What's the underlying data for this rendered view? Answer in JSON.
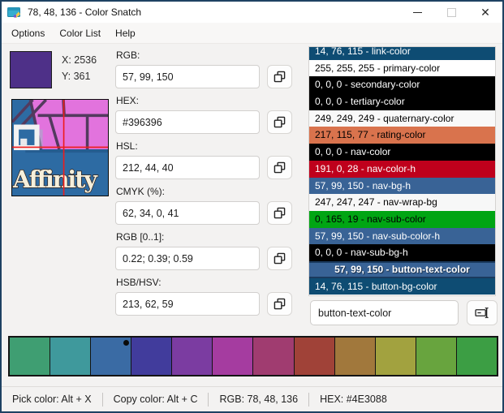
{
  "window": {
    "title": "78, 48, 136 - Color Snatch"
  },
  "menu": {
    "items": [
      "Options",
      "Color List",
      "Help"
    ]
  },
  "picker": {
    "coord_x": "X: 2536",
    "coord_y": "Y: 361",
    "swatch_color": "#4E3088",
    "preview_label": "Affinity"
  },
  "fields": [
    {
      "label": "RGB:",
      "value": "57, 99, 150"
    },
    {
      "label": "HEX:",
      "value": "#396396"
    },
    {
      "label": "HSL:",
      "value": "212, 44, 40"
    },
    {
      "label": "CMYK (%):",
      "value": "62, 34, 0, 41"
    },
    {
      "label": "RGB [0..1]:",
      "value": "0.22; 0.39; 0.59"
    },
    {
      "label": "HSB/HSV:",
      "value": "213, 62, 59"
    }
  ],
  "color_list": {
    "items": [
      {
        "text": "14, 76, 115 - link-color",
        "bg": "#0E4C73",
        "fg": "#FFFFFF",
        "selected": false
      },
      {
        "text": "255, 255, 255 - primary-color",
        "bg": "#FFFFFF",
        "fg": "#000000",
        "selected": false
      },
      {
        "text": "0, 0, 0 - secondary-color",
        "bg": "#000000",
        "fg": "#FFFFFF",
        "selected": false
      },
      {
        "text": "0, 0, 0 - tertiary-color",
        "bg": "#000000",
        "fg": "#FFFFFF",
        "selected": false
      },
      {
        "text": "249, 249, 249 - quaternary-color",
        "bg": "#F9F9F9",
        "fg": "#000000",
        "selected": false
      },
      {
        "text": "217, 115, 77 - rating-color",
        "bg": "#D9734D",
        "fg": "#000000",
        "selected": false
      },
      {
        "text": "0, 0, 0 - nav-color",
        "bg": "#000000",
        "fg": "#FFFFFF",
        "selected": false
      },
      {
        "text": "191, 0, 28 - nav-color-h",
        "bg": "#BF001C",
        "fg": "#FFFFFF",
        "selected": false
      },
      {
        "text": "57, 99, 150 - nav-bg-h",
        "bg": "#396396",
        "fg": "#FFFFFF",
        "selected": false
      },
      {
        "text": "247, 247, 247 - nav-wrap-bg",
        "bg": "#F7F7F7",
        "fg": "#000000",
        "selected": false
      },
      {
        "text": "0, 165, 19 - nav-sub-color",
        "bg": "#00A513",
        "fg": "#000000",
        "selected": false
      },
      {
        "text": "57, 99, 150 - nav-sub-color-h",
        "bg": "#396396",
        "fg": "#FFFFFF",
        "selected": false
      },
      {
        "text": "0, 0, 0 - nav-sub-bg-h",
        "bg": "#000000",
        "fg": "#FFFFFF",
        "selected": false
      },
      {
        "text": "57, 99, 150 - button-text-color",
        "bg": "#396396",
        "fg": "#FFFFFF",
        "selected": true
      },
      {
        "text": "14, 76, 115 - button-bg-color",
        "bg": "#0E4C73",
        "fg": "#FFFFFF",
        "selected": false
      }
    ],
    "name_input_value": "button-text-color"
  },
  "palette": {
    "colors": [
      "#3F9E72",
      "#3F999C",
      "#3A6BA4",
      "#413C9C",
      "#7B3CA1",
      "#A53CA0",
      "#A03C70",
      "#A04238",
      "#A1783C",
      "#A2A23F",
      "#68A43E",
      "#3C9E44"
    ],
    "marker_index": 2
  },
  "statusbar": {
    "items": [
      "Pick color: Alt + X",
      "Copy color: Alt + C",
      "RGB: 78, 48, 136",
      "HEX: #4E3088"
    ]
  }
}
